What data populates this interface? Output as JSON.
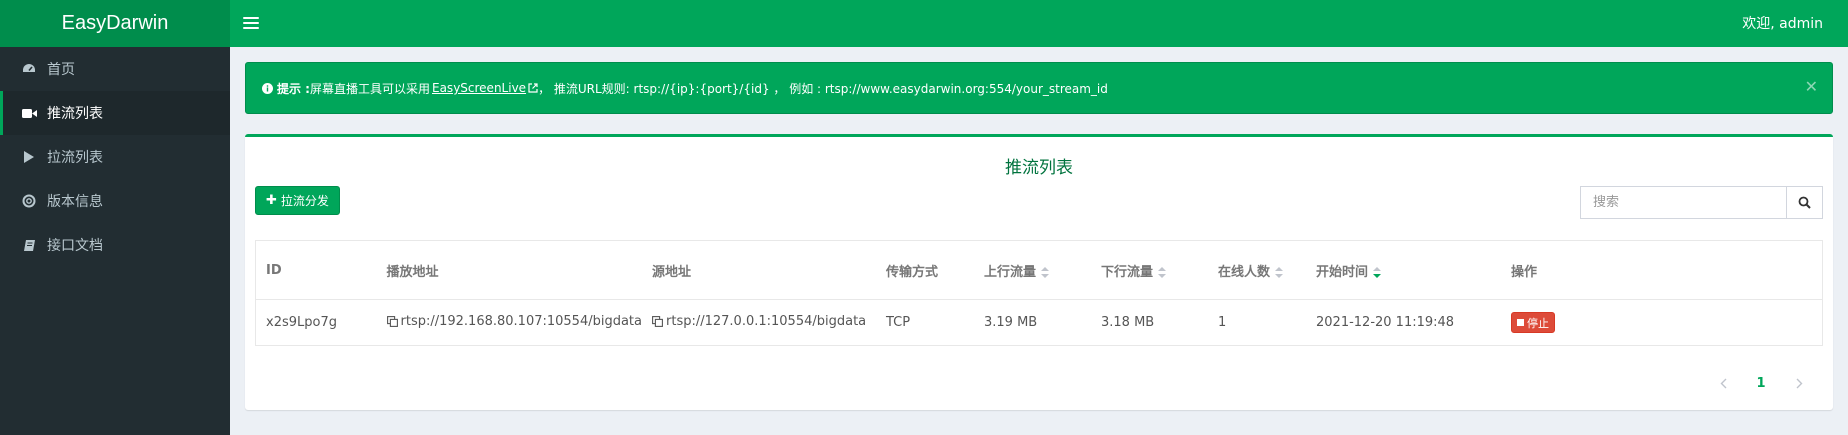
{
  "header": {
    "logo": "EasyDarwin",
    "welcome": "欢迎, admin"
  },
  "sidebar": {
    "items": [
      {
        "label": "首页",
        "icon": "dashboard-icon"
      },
      {
        "label": "推流列表",
        "icon": "video-camera-icon",
        "active": true
      },
      {
        "label": "拉流列表",
        "icon": "play-icon"
      },
      {
        "label": "版本信息",
        "icon": "lifebuoy-icon"
      },
      {
        "label": "接口文档",
        "icon": "book-icon"
      }
    ]
  },
  "alert": {
    "label": "提示 :",
    "text_before": " 屏幕直播工具可以采用 ",
    "link": "EasyScreenLive",
    "text_after": "， 推流URL规则: rtsp://{ip}:{port}/{id} ， 例如 : rtsp://www.easydarwin.org:554/your_stream_id"
  },
  "panel": {
    "title": "推流列表",
    "pull_button": "拉流分发",
    "search_placeholder": "搜索"
  },
  "table": {
    "headers": [
      "ID",
      "播放地址",
      "源地址",
      "传输方式",
      "上行流量",
      "下行流量",
      "在线人数",
      "开始时间",
      "操作"
    ],
    "rows": [
      {
        "id": "x2s9Lpo7g",
        "play_url": "rtsp://192.168.80.107:10554/bigdata",
        "source_url": "rtsp://127.0.0.1:10554/bigdata",
        "transport": "TCP",
        "upstream": "3.19 MB",
        "downstream": "3.18 MB",
        "online": "1",
        "start_time": "2021-12-20 11:19:48",
        "action": "停止"
      }
    ]
  },
  "pagination": {
    "current": "1"
  },
  "colors": {
    "brand": "#00a65a",
    "brand_dark": "#008d4c",
    "sidebar": "#222d32",
    "danger": "#dd4b39"
  }
}
